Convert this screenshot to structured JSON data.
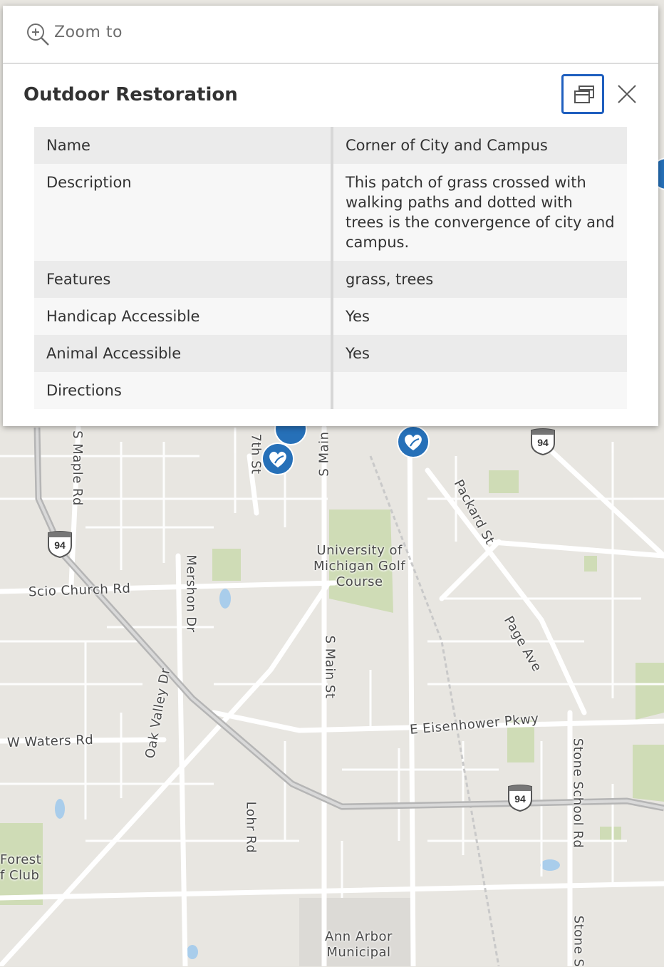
{
  "zoom": {
    "label": "Zoom to",
    "icon": "zoom-in-icon"
  },
  "popup": {
    "title": "Outdoor Restoration",
    "dock_icon": "dock-icon",
    "close_icon": "close-icon",
    "rows": [
      {
        "key": "Name",
        "value": "Corner of City and Campus"
      },
      {
        "key": "Description",
        "value": "This patch of grass crossed with walking paths and dotted with trees is the convergence of city and campus."
      },
      {
        "key": "Features",
        "value": "grass, trees"
      },
      {
        "key": "Handicap Accessible",
        "value": "Yes"
      },
      {
        "key": "Animal Accessible",
        "value": "Yes"
      },
      {
        "key": "Directions",
        "value": ""
      }
    ]
  },
  "map": {
    "labels": {
      "maple": "S Maple Rd",
      "seventh": "7th St",
      "smain_top": "S Main",
      "packard": "Packard St",
      "golf": "University of\nMichigan Golf\nCourse",
      "mershon": "Mershon Dr",
      "scio": "Scio Church Rd",
      "smain": "S Main St",
      "page": "Page Ave",
      "oakvalley": "Oak Valley Dr",
      "eisenhower": "E Eisenhower Pkwy",
      "waters": "W Waters Rd",
      "stone": "Stone School Rd",
      "stone2": "Stone S",
      "lohr": "Lohr Rd",
      "forest": "Forest\nf Club",
      "airport": "Ann Arbor\nMunicipal"
    },
    "shields": [
      "94",
      "94",
      "94"
    ],
    "marker_icon": "heart-leaf-icon",
    "colors": {
      "marker": "#2670b8",
      "highway": "#b8b8b8",
      "park": "#c5d9a9"
    }
  }
}
